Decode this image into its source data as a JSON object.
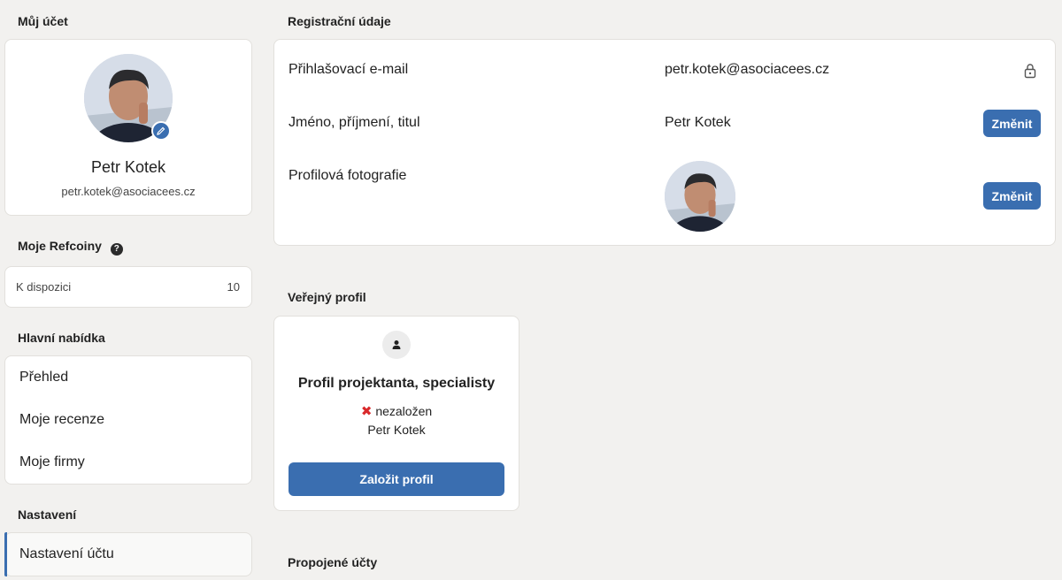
{
  "account": {
    "title": "Můj účet",
    "name": "Petr Kotek",
    "email": "petr.kotek@asociacees.cz"
  },
  "refcoins": {
    "title": "Moje Refcoiny",
    "help_icon": "question-circle-icon",
    "available_label": "K dispozici",
    "available_value": "10"
  },
  "main_menu": {
    "title": "Hlavní nabídka",
    "items": [
      {
        "label": "Přehled"
      },
      {
        "label": "Moje recenze"
      },
      {
        "label": "Moje firmy"
      }
    ]
  },
  "settings_menu": {
    "title": "Nastavení",
    "items": [
      {
        "label": "Nastavení účtu",
        "active": true
      }
    ]
  },
  "registration": {
    "title": "Registrační údaje",
    "rows": [
      {
        "label": "Přihlašovací e-mail",
        "value": "petr.kotek@asociacees.cz",
        "icon": "lock-icon"
      },
      {
        "label": "Jméno, příjmení, titul",
        "value": "Petr Kotek",
        "button": "Změnit"
      },
      {
        "label": "Profilová fotografie",
        "button": "Změnit"
      }
    ]
  },
  "public_profile": {
    "title": "Veřejný profil",
    "card_title": "Profil projektanta, specialisty",
    "status": "nezaložen",
    "owner": "Petr Kotek",
    "button": "Založit profil"
  },
  "linked_accounts": {
    "title": "Propojené účty"
  },
  "colors": {
    "accent": "#3a6eb0",
    "background": "#f2f1ef",
    "error": "#d9292b"
  }
}
